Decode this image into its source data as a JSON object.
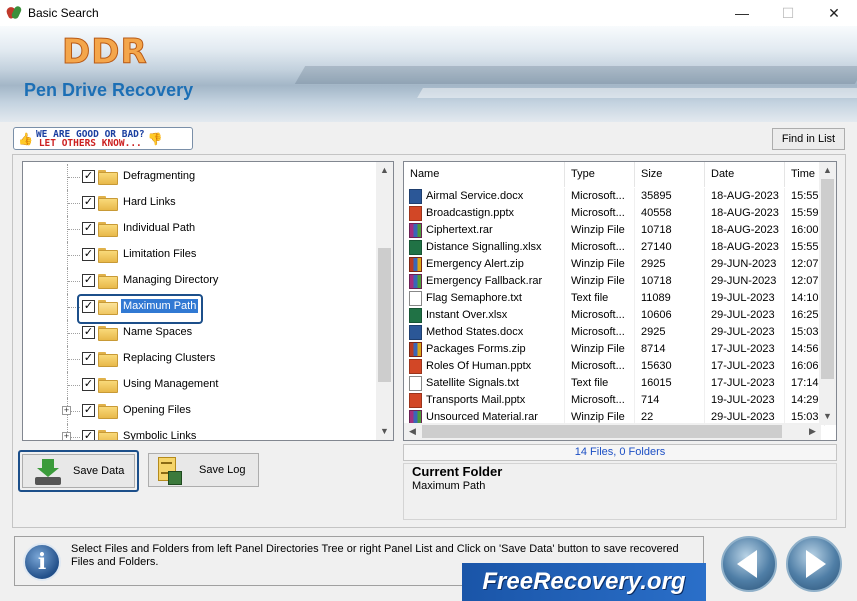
{
  "window": {
    "title": "Basic Search",
    "controls": {
      "minimize": "—",
      "maximize": "☐",
      "close": "✕"
    }
  },
  "banner": {
    "logo": "DDR",
    "product": "Pen Drive Recovery"
  },
  "rate": {
    "line1": "WE ARE GOOD OR BAD?",
    "line2": "LET OTHERS KNOW..."
  },
  "toolbar": {
    "find_label": "Find in List"
  },
  "tree": {
    "items": [
      {
        "label": "Defragmenting",
        "checked": true,
        "expander": false
      },
      {
        "label": "Hard Links",
        "checked": true,
        "expander": false
      },
      {
        "label": "Individual Path",
        "checked": true,
        "expander": false
      },
      {
        "label": "Limitation Files",
        "checked": true,
        "expander": false
      },
      {
        "label": "Managing Directory",
        "checked": true,
        "expander": false
      },
      {
        "label": "Maximum Path",
        "checked": true,
        "expander": false,
        "selected": true
      },
      {
        "label": "Name Spaces",
        "checked": true,
        "expander": false
      },
      {
        "label": "Replacing Clusters",
        "checked": true,
        "expander": false
      },
      {
        "label": "Using Management",
        "checked": true,
        "expander": false
      },
      {
        "label": "Opening Files",
        "checked": true,
        "expander": true
      },
      {
        "label": "Symbolic Links",
        "checked": true,
        "expander": true
      }
    ]
  },
  "list": {
    "columns": [
      "Name",
      "Type",
      "Size",
      "Date",
      "Time"
    ],
    "rows": [
      {
        "icon": "docx",
        "name": "Airmal Service.docx",
        "type": "Microsoft...",
        "size": "35895",
        "date": "18-AUG-2023",
        "time": "15:55"
      },
      {
        "icon": "pptx",
        "name": "Broadcastign.pptx",
        "type": "Microsoft...",
        "size": "40558",
        "date": "18-AUG-2023",
        "time": "15:59"
      },
      {
        "icon": "rar",
        "name": "Ciphertext.rar",
        "type": "Winzip File",
        "size": "10718",
        "date": "18-AUG-2023",
        "time": "16:00"
      },
      {
        "icon": "xlsx",
        "name": "Distance Signalling.xlsx",
        "type": "Microsoft...",
        "size": "27140",
        "date": "18-AUG-2023",
        "time": "15:55"
      },
      {
        "icon": "zip",
        "name": "Emergency Alert.zip",
        "type": "Winzip File",
        "size": "2925",
        "date": "29-JUN-2023",
        "time": "12:07"
      },
      {
        "icon": "rar",
        "name": "Emergency Fallback.rar",
        "type": "Winzip File",
        "size": "10718",
        "date": "29-JUN-2023",
        "time": "12:07"
      },
      {
        "icon": "txt",
        "name": "Flag Semaphore.txt",
        "type": "Text file",
        "size": "11089",
        "date": "19-JUL-2023",
        "time": "14:10"
      },
      {
        "icon": "xlsx",
        "name": "Instant Over.xlsx",
        "type": "Microsoft...",
        "size": "10606",
        "date": "29-JUL-2023",
        "time": "16:25"
      },
      {
        "icon": "docx",
        "name": "Method States.docx",
        "type": "Microsoft...",
        "size": "2925",
        "date": "29-JUL-2023",
        "time": "15:03"
      },
      {
        "icon": "zip",
        "name": "Packages Forms.zip",
        "type": "Winzip File",
        "size": "8714",
        "date": "17-JUL-2023",
        "time": "14:56"
      },
      {
        "icon": "pptx",
        "name": "Roles Of Human.pptx",
        "type": "Microsoft...",
        "size": "15630",
        "date": "17-JUL-2023",
        "time": "16:06"
      },
      {
        "icon": "txt",
        "name": "Satellite Signals.txt",
        "type": "Text file",
        "size": "16015",
        "date": "17-JUL-2023",
        "time": "17:14"
      },
      {
        "icon": "pptx",
        "name": "Transports Mail.pptx",
        "type": "Microsoft...",
        "size": "714",
        "date": "19-JUL-2023",
        "time": "14:29"
      },
      {
        "icon": "rar",
        "name": "Unsourced Material.rar",
        "type": "Winzip File",
        "size": "22",
        "date": "29-JUL-2023",
        "time": "15:03"
      }
    ]
  },
  "count": "14 Files, 0 Folders",
  "current_folder": {
    "title": "Current Folder",
    "value": "Maximum Path"
  },
  "buttons": {
    "save_data": "Save Data",
    "save_log": "Save Log"
  },
  "status": {
    "text": "Select Files and Folders from left Panel Directories Tree or right Panel List and Click on 'Save Data' button to save recovered Files and Folders."
  },
  "watermark": "FreeRecovery.org"
}
